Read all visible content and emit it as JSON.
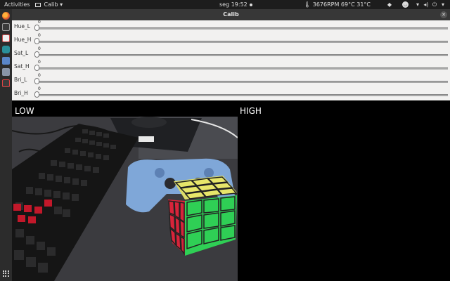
{
  "top_bar": {
    "activities": "Activities",
    "app_name": "Calib",
    "clock": "seg 19:52",
    "sensors": "3676RPM 69°C 31°C",
    "icons": [
      "dropbox-icon",
      "chat-icon",
      "wifi-icon",
      "volume-icon",
      "power-icon"
    ]
  },
  "window": {
    "title": "Calib"
  },
  "sliders": [
    {
      "label": "Hue_L",
      "value": "0"
    },
    {
      "label": "Hue_H",
      "value": "0"
    },
    {
      "label": "Sat_L",
      "value": "0"
    },
    {
      "label": "Sat_H",
      "value": "0"
    },
    {
      "label": "Bri_L",
      "value": "0"
    },
    {
      "label": "Bri_H",
      "value": "0"
    }
  ],
  "panels": {
    "low_label": "LOW",
    "high_label": "HIGH"
  },
  "colors": {
    "panel_bg": "#1d1d1d",
    "dock_bg": "#2c2c2c",
    "controls_bg": "#f2f1f0",
    "cube_red": "#d8243a",
    "cube_green": "#2fcf55",
    "cube_yellow": "#e7e66a",
    "controller_blue": "#7fa7d8"
  }
}
